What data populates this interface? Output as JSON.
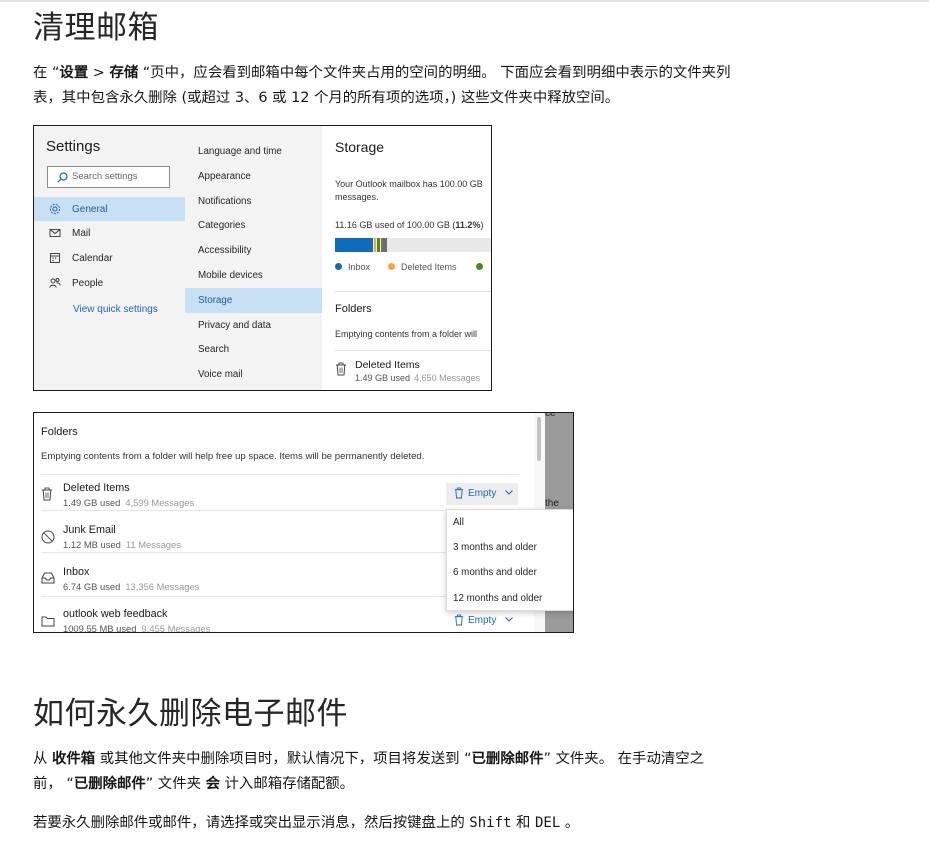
{
  "section1": {
    "heading": "清理邮箱",
    "para_line1_parts": [
      "在 “",
      "设置",
      " > ",
      "存储",
      " “页中，应会看到邮箱中每个文件夹占用的空间的明细。 下面应会看到明细中表示的文件夹列"
    ],
    "para_line2": "表，其中包含永久删除 (或超过 3、6 或 12 个月的所有项的选项，) 这些文件夹中释放空间。"
  },
  "screenshot1": {
    "settings_title": "Settings",
    "search_placeholder": "Search settings",
    "nav": [
      {
        "label": "General",
        "icon": "gear-icon",
        "selected": true
      },
      {
        "label": "Mail",
        "icon": "mail-icon",
        "selected": false
      },
      {
        "label": "Calendar",
        "icon": "calendar-icon",
        "selected": false
      },
      {
        "label": "People",
        "icon": "people-icon",
        "selected": false
      }
    ],
    "quick_settings": "View quick settings",
    "subnav": [
      {
        "label": "Language and time",
        "selected": false
      },
      {
        "label": "Appearance",
        "selected": false
      },
      {
        "label": "Notifications",
        "selected": false
      },
      {
        "label": "Categories",
        "selected": false
      },
      {
        "label": "Accessibility",
        "selected": false
      },
      {
        "label": "Mobile devices",
        "selected": false
      },
      {
        "label": "Storage",
        "selected": true
      },
      {
        "label": "Privacy and data",
        "selected": false
      },
      {
        "label": "Search",
        "selected": false
      },
      {
        "label": "Voice mail",
        "selected": false
      }
    ],
    "storage_title": "Storage",
    "storage_desc_line1": "Your Outlook mailbox has 100.00 GB",
    "storage_desc_line2": "messages.",
    "usage_prefix": "11.16 GB used of 100.00 GB (",
    "usage_percent": "11.2%",
    "usage_suffix": ")",
    "bar_segments": [
      {
        "color": "#0f6cbd",
        "fraction": 0.245
      },
      {
        "color": "#f7a633",
        "fraction": 0.015
      },
      {
        "color": "#4a8a1c",
        "fraction": 0.025
      },
      {
        "color": "#8a7a2a",
        "fraction": 0.01
      },
      {
        "color": "#6e6e6e",
        "fraction": 0.035
      }
    ],
    "legend": [
      {
        "label": "Inbox",
        "color": "#0f6cbd"
      },
      {
        "label": "Deleted Items",
        "color": "#f7a633"
      },
      {
        "label": "",
        "color": "#4a8a1c"
      }
    ],
    "folders_title": "Folders",
    "folders_desc": "Emptying contents from a folder will",
    "item_name": "Deleted Items",
    "item_size": "1.49 GB used",
    "item_count": "4,650 Messages"
  },
  "screenshot2": {
    "folders_title": "Folders",
    "folders_desc": "Emptying contents from a folder will help free up space. Items will be permanently deleted.",
    "rows": [
      {
        "name": "Deleted Items",
        "size": "1.49 GB used",
        "count": "4,599 Messages",
        "icon": "trash-icon"
      },
      {
        "name": "Junk Email",
        "size": "1.12 MB used",
        "count": "11 Messages",
        "icon": "blocked-icon"
      },
      {
        "name": "Inbox",
        "size": "6.74 GB used",
        "count": "13,356 Messages",
        "icon": "inbox-icon"
      },
      {
        "name": "outlook web feedback",
        "size": "1009.55 MB used",
        "count": "9,455 Messages",
        "icon": "folder-icon"
      }
    ],
    "empty_label": "Empty",
    "menu": [
      "All",
      "3 months and older",
      "6 months and older",
      "12 months and older"
    ],
    "side_text_1": "ce",
    "side_text_2": "the"
  },
  "section2": {
    "heading": "如何永久删除电子邮件",
    "para1_line1_parts": [
      "从 ",
      "收件箱",
      " 或其他文件夹中删除项目时，默认情况下，项目将发送到 “",
      "已删除邮件",
      "” 文件夹。 在手动清空之"
    ],
    "para1_line2_parts": [
      "前， “",
      "已删除邮件",
      "” 文件夹 ",
      "会",
      " 计入邮箱存储配额。"
    ],
    "para2_parts": [
      "若要永久删除邮件或邮件，请选择或突出显示消息，然后按键盘上的 ",
      "Shift",
      " 和 ",
      "DEL",
      " 。"
    ]
  }
}
